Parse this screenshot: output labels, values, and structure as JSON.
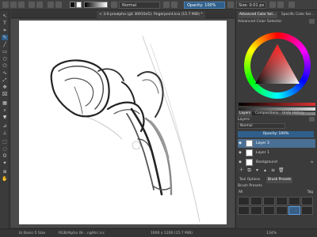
{
  "toolbar": {
    "blend_mode": "Normal",
    "opacity": "Opacity: 100%",
    "size": "Size: 0.01 px"
  },
  "document": {
    "tab_title": "< 3.0-prealpha (git 30910e5): fingerpoint.kra (15.7 MiB) *"
  },
  "dock": {
    "color_tabs": [
      "Advanced Color Sel...",
      "Specific Color Sel..."
    ],
    "color_panel_title": "Advanced Color Selector",
    "layer_tabs": [
      "Layers",
      "Compositions",
      "Undo History"
    ],
    "layers_title": "Layers",
    "layer_blend_mode": "Normal",
    "layer_opacity": "Opacity: 100%",
    "layers": [
      {
        "name": "Layer 3",
        "selected": true
      },
      {
        "name": "Layer 1",
        "selected": false
      },
      {
        "name": "Background",
        "selected": false
      }
    ],
    "brush_tabs": [
      "Tool Options",
      "Brush Presets"
    ],
    "brush_title": "Brush Presets",
    "brush_filter_all": "All",
    "brush_tag_label": "Tag"
  },
  "status": {
    "brush": "b) Basic-5 Size",
    "color_profile": "RGB/Alpha (8-...nghtrc.icc",
    "dimensions": "1600 x 1200 (15.7 MiB)",
    "zoom": "134%"
  },
  "colors": {
    "accent": "#2f5f8a",
    "selected_layer": "#4a6f94"
  }
}
